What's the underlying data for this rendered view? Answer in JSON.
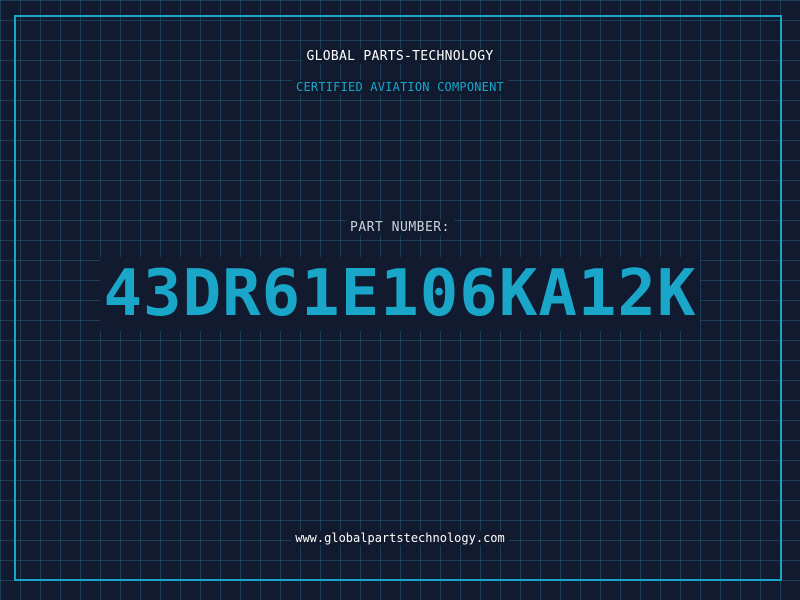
{
  "label": {
    "company": "GLOBAL PARTS-TECHNOLOGY",
    "subtitle": "CERTIFIED AVIATION COMPONENT",
    "part_number_label": "PART NUMBER:",
    "part_number": "43DR61E106KA12K",
    "website": "www.globalpartstechnology.com"
  },
  "colors": {
    "background": "#111a2e",
    "grid": "#205c78",
    "accent": "#1aa6c9",
    "text": "#ffffff"
  }
}
